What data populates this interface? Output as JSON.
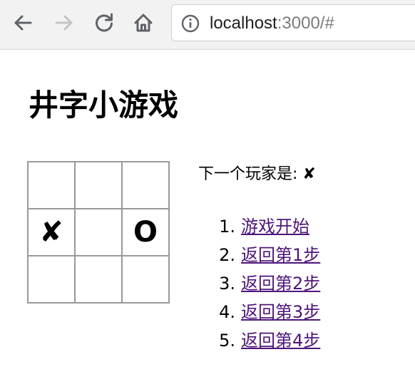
{
  "browser": {
    "url_host": "localhost",
    "url_rest": ":3000/#",
    "icons": {
      "back": "arrow-left-icon",
      "forward": "arrow-right-icon",
      "reload": "reload-icon",
      "home": "home-icon",
      "info": "info-icon"
    }
  },
  "page": {
    "title": "井字小游戏"
  },
  "board": {
    "squares": [
      "",
      "",
      "",
      "✘",
      "",
      "O",
      "",
      "",
      ""
    ]
  },
  "status": "下一个玩家是: ✘",
  "moves": [
    {
      "num": "1.",
      "label": "游戏开始"
    },
    {
      "num": "2.",
      "label": "返回第1步"
    },
    {
      "num": "3.",
      "label": "返回第2步"
    },
    {
      "num": "4.",
      "label": "返回第3步"
    },
    {
      "num": "5.",
      "label": "返回第4步"
    }
  ],
  "colors": {
    "link": "#4e157a",
    "board_border": "#999999",
    "toolbar_bg": "#f2f2f2"
  }
}
